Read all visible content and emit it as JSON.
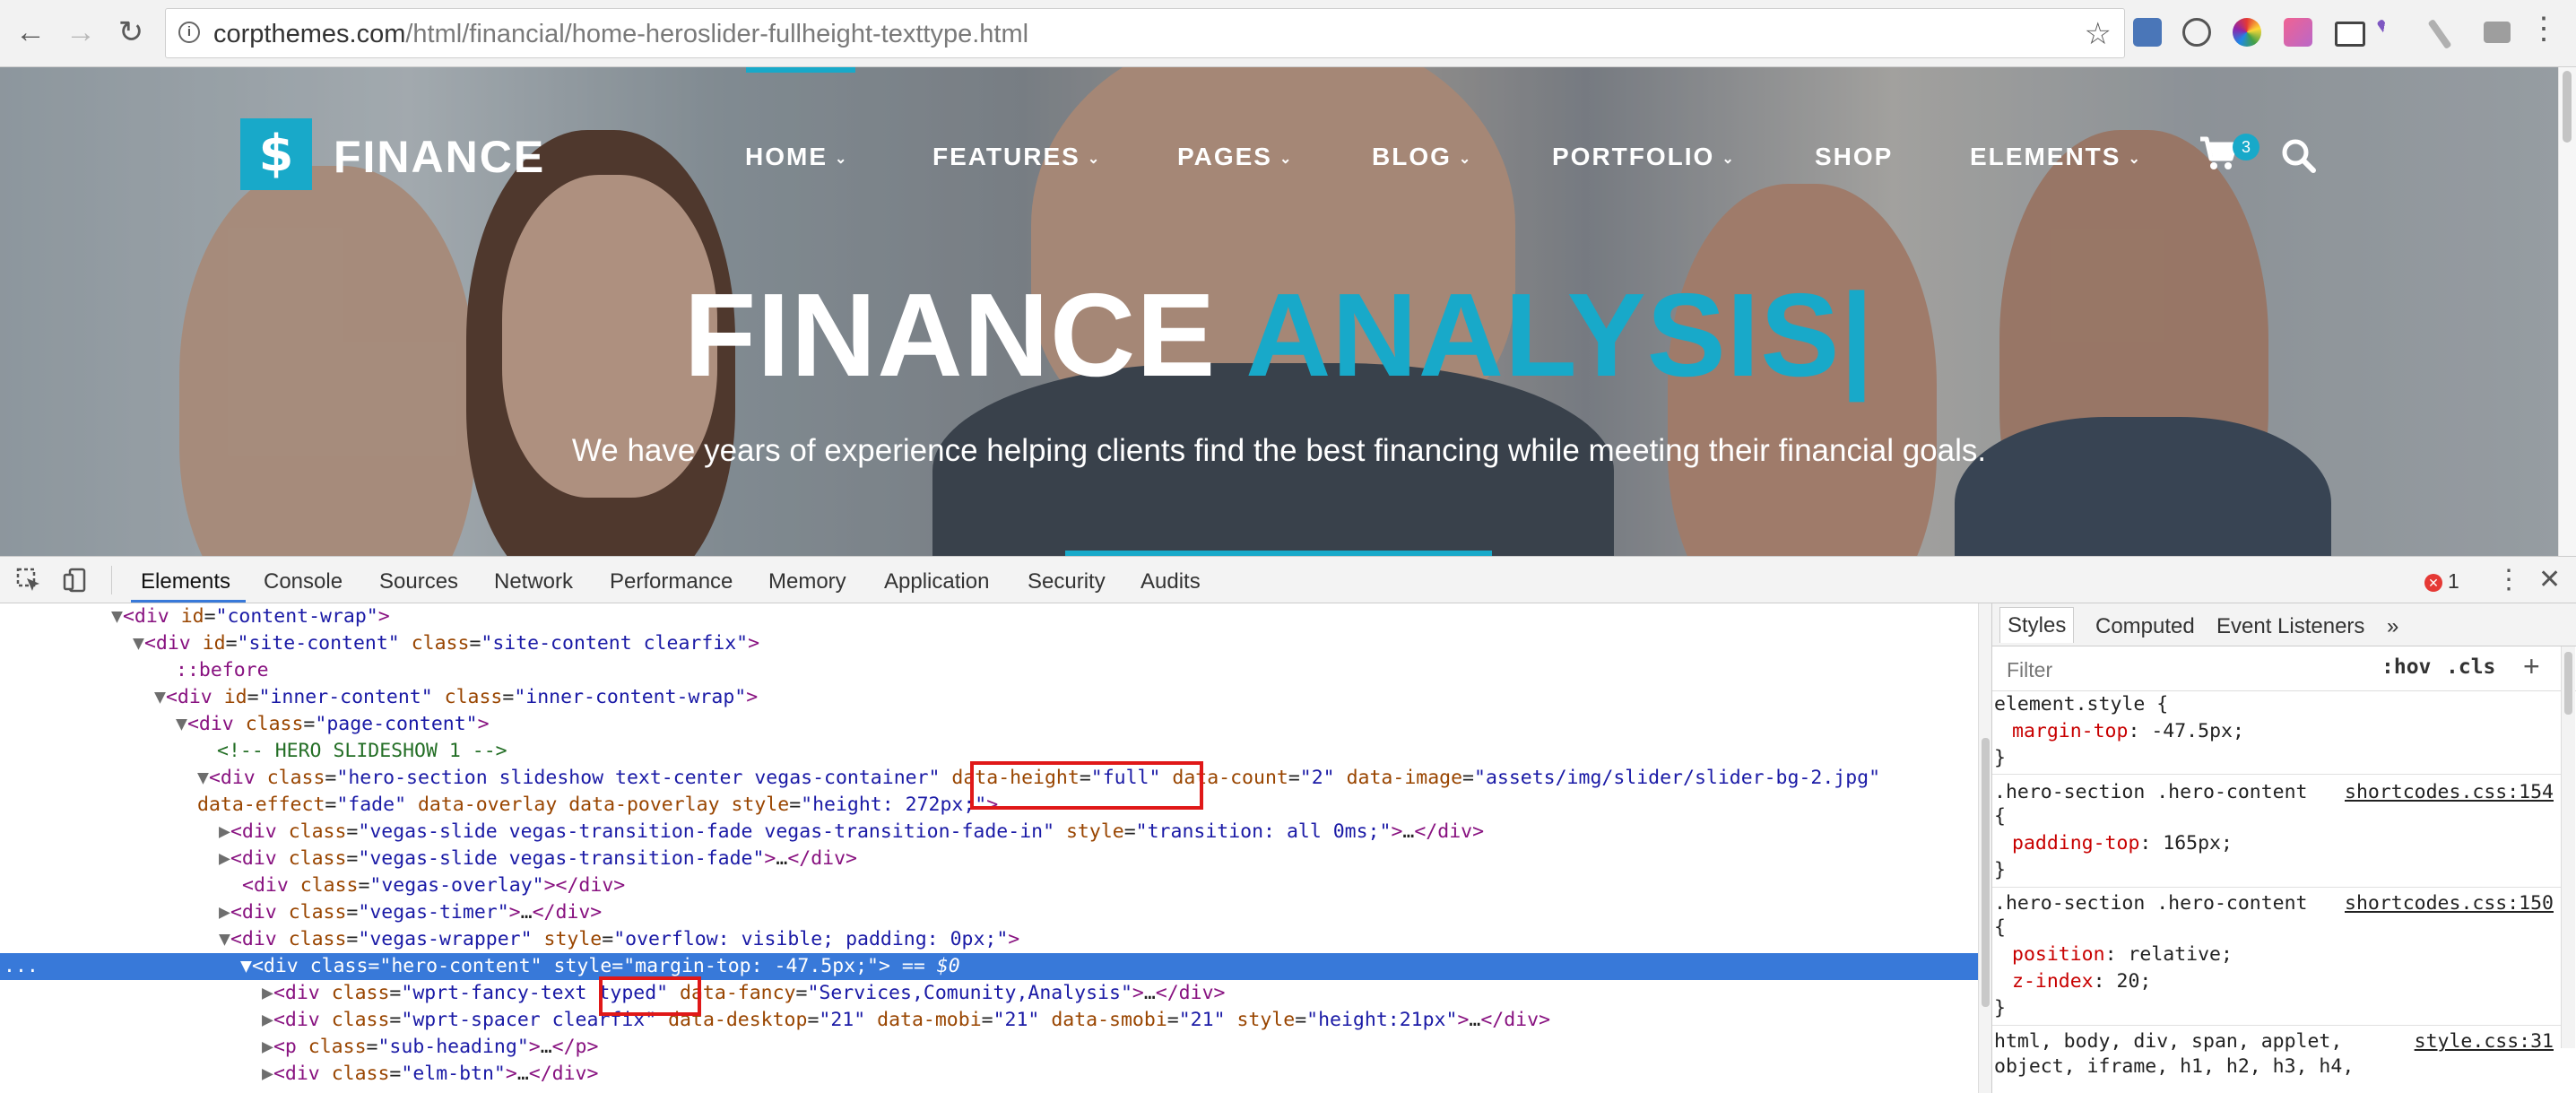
{
  "browser": {
    "url_host": "corpthemes.com",
    "url_path": "/html/financial/home-heroslider-fullheight-texttype.html",
    "back_icon": "←",
    "forward_icon": "→",
    "reload_icon": "↻",
    "star_icon": "☆",
    "menu_icon": "⋮"
  },
  "site": {
    "logo_glyph": "$",
    "logo_text": "FINANCE",
    "accent_color": "#18a9c9",
    "menu": [
      {
        "label": "HOME",
        "caret": "⌄"
      },
      {
        "label": "FEATURES",
        "caret": "⌄"
      },
      {
        "label": "PAGES",
        "caret": "⌄"
      },
      {
        "label": "BLOG",
        "caret": "⌄"
      },
      {
        "label": "PORTFOLIO",
        "caret": "⌄"
      },
      {
        "label": "SHOP",
        "caret": ""
      },
      {
        "label": "ELEMENTS",
        "caret": "⌄"
      }
    ],
    "cart_count": "3",
    "hero_title_white": "FINANCE ",
    "hero_title_accent": "ANALYSIS|",
    "hero_subtitle": "We have years of experience helping clients find the best financing while meeting their financial goals."
  },
  "devtools": {
    "tabs": [
      "Elements",
      "Console",
      "Sources",
      "Network",
      "Performance",
      "Memory",
      "Application",
      "Security",
      "Audits"
    ],
    "active_tab": "Elements",
    "error_count": "1",
    "close_icon": "✕",
    "menu_icon": "⋮",
    "dom_lines": [
      "▼<div id=\"content-wrap\">",
      "▼<div id=\"site-content\" class=\"site-content clearfix\">",
      "::before",
      "▼<div id=\"inner-content\" class=\"inner-content-wrap\">",
      "▼<div class=\"page-content\">",
      "<!-- HERO SLIDESHOW 1 -->",
      "▼<div class=\"hero-section slideshow text-center vegas-container\" data-height=\"full\" data-count=\"2\" data-image=\"assets/img/slider/slider-bg-2.jpg\"",
      "data-effect=\"fade\" data-overlay data-poverlay style=\"height: 272px;\">",
      "▶<div class=\"vegas-slide vegas-transition-fade vegas-transition-fade-in\" style=\"transition: all 0ms;\">…</div>",
      "▶<div class=\"vegas-slide vegas-transition-fade\">…</div>",
      "<div class=\"vegas-overlay\"></div>",
      "▶<div class=\"vegas-timer\">…</div>",
      "▼<div class=\"vegas-wrapper\" style=\"overflow: visible; padding: 0px;\">",
      "▼<div class=\"hero-content\" style=\"margin-top: -47.5px;\"> == $0",
      "▶<div class=\"wprt-fancy-text typed\" data-fancy=\"Services,Comunity,Analysis\">…</div>",
      "▶<div class=\"wprt-spacer clearfix\" data-desktop=\"21\" data-mobi=\"21\" data-smobi=\"21\" style=\"height:21px\">…</div>",
      "▶<p class=\"sub-heading\">…</p>",
      "▶<div class=\"elm-btn\">…</div>"
    ],
    "selected_ellipsis": "...",
    "styles_tabs": [
      "Styles",
      "Computed",
      "Event Listeners",
      "»"
    ],
    "filter_placeholder": "Filter",
    "hov_label": ":hov",
    "cls_label": ".cls",
    "plus_label": "+",
    "rules": [
      {
        "selector": "element.style {",
        "source": "",
        "props": [
          {
            "name": "margin-top",
            "value": "-47.5px;"
          }
        ]
      },
      {
        "selector": ".hero-section .hero-content",
        "source": "shortcodes.css:154",
        "props": [
          {
            "name": "padding-top",
            "value": "165px;"
          }
        ]
      },
      {
        "selector": ".hero-section .hero-content",
        "source": "shortcodes.css:150",
        "props": [
          {
            "name": "position",
            "value": "relative;"
          },
          {
            "name": "z-index",
            "value": "20;"
          }
        ]
      },
      {
        "selector": "html, body, div, span, applet,",
        "source": "style.css:31",
        "props": []
      }
    ],
    "rule_tail": "object, iframe, h1, h2, h3, h4,"
  }
}
